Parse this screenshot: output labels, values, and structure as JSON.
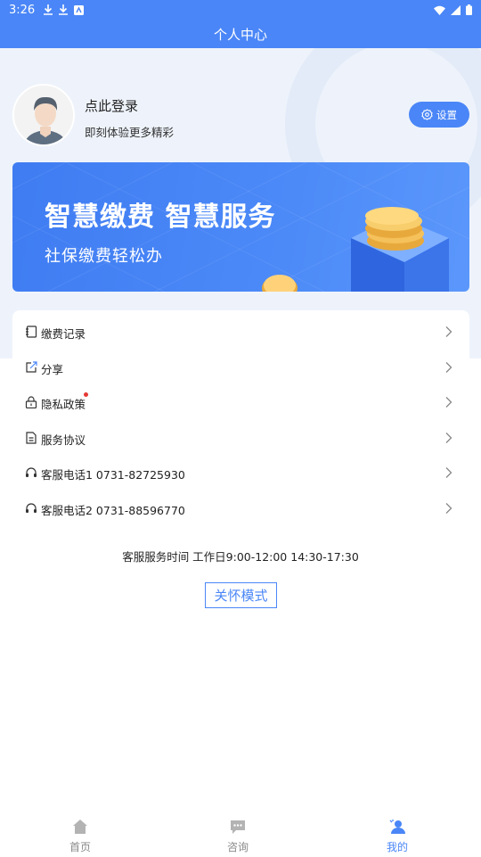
{
  "status_bar": {
    "time": "3:26"
  },
  "header": {
    "title": "个人中心"
  },
  "profile": {
    "login_title": "点此登录",
    "login_subtitle": "即刻体验更多精彩",
    "settings_label": "设置"
  },
  "banner": {
    "title": "智慧缴费  智慧服务",
    "subtitle": "社保缴费轻松办"
  },
  "menu": {
    "items": [
      {
        "label": "缴费记录",
        "icon": "notebook-icon"
      },
      {
        "label": "分享",
        "icon": "share-icon"
      },
      {
        "label": "隐私政策",
        "icon": "lock-icon",
        "badge": true
      },
      {
        "label": "服务协议",
        "icon": "document-icon"
      },
      {
        "label": "客服电话1 0731-82725930",
        "icon": "headset-icon"
      },
      {
        "label": "客服电话2 0731-88596770",
        "icon": "headset-icon"
      }
    ]
  },
  "service_hours": "客服服务时间 工作日9:00-12:00 14:30-17:30",
  "care_mode_label": "关怀模式",
  "tabs": [
    {
      "label": "首页",
      "icon": "home-icon",
      "active": false
    },
    {
      "label": "咨询",
      "icon": "chat-icon",
      "active": false
    },
    {
      "label": "我的",
      "icon": "user-icon",
      "active": true
    }
  ],
  "colors": {
    "primary": "#4a86f7",
    "badge_red": "#e53935",
    "bg_light": "#eef3fb"
  }
}
